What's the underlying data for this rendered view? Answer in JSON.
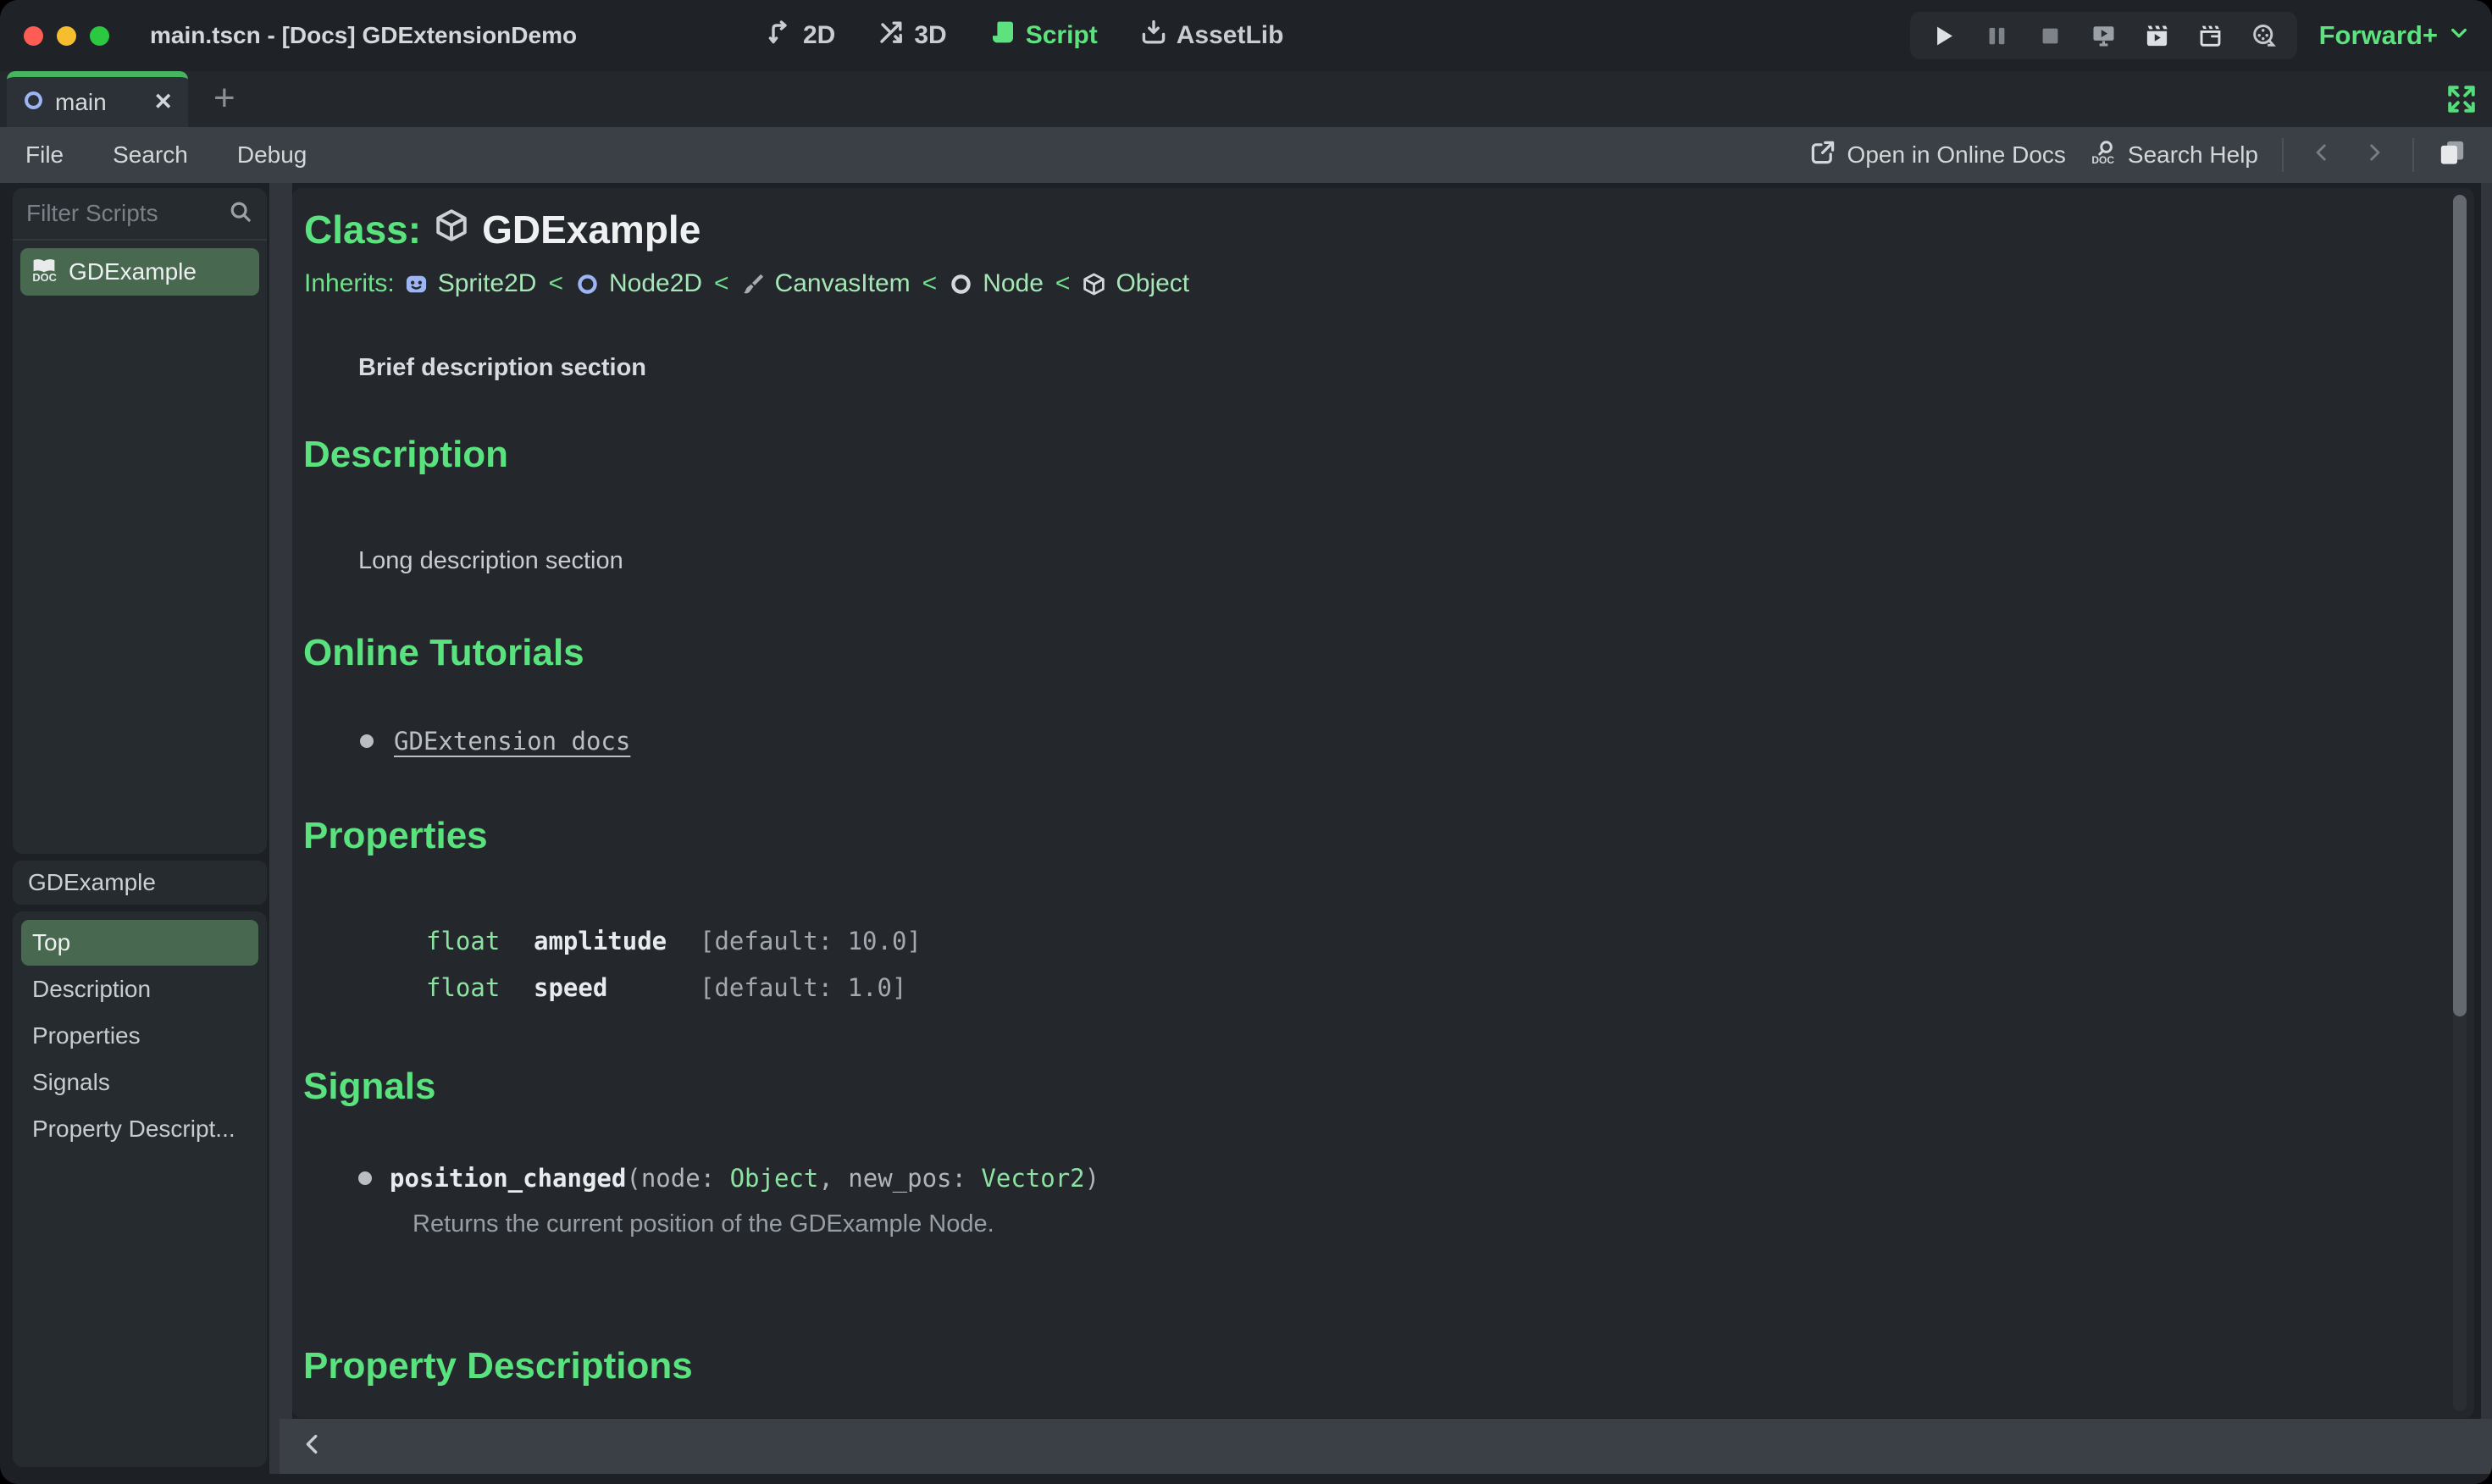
{
  "titlebar": {
    "title": "main.tscn - [Docs] GDExtensionDemo",
    "workspaces": {
      "d2": "2D",
      "d3": "3D",
      "script": "Script",
      "assetlib": "AssetLib"
    },
    "renderer": "Forward+"
  },
  "tabbar": {
    "tab": "main"
  },
  "icons": {
    "close": "✕",
    "plus": "+"
  },
  "menubar": {
    "file": "File",
    "search": "Search",
    "debug": "Debug",
    "open_online_docs": "Open in Online Docs",
    "search_help": "Search Help"
  },
  "sidebar": {
    "filter_placeholder": "Filter Scripts",
    "script_item": "GDExample",
    "member_filter": "GDExample",
    "members": [
      {
        "label": "Top"
      },
      {
        "label": "Description"
      },
      {
        "label": "Properties"
      },
      {
        "label": "Signals"
      },
      {
        "label": "Property Descript..."
      }
    ]
  },
  "doc": {
    "class_label": "Class:",
    "class_name": "GDExample",
    "inherits_label": "Inherits:",
    "sep": "<",
    "chain": [
      {
        "name": "Sprite2D"
      },
      {
        "name": "Node2D"
      },
      {
        "name": "CanvasItem"
      },
      {
        "name": "Node"
      },
      {
        "name": "Object"
      }
    ],
    "brief": "Brief description section",
    "description": {
      "title": "Description",
      "body": "Long description section"
    },
    "tutorials": {
      "title": "Online Tutorials",
      "link": "GDExtension docs"
    },
    "properties": {
      "title": "Properties",
      "rows": [
        {
          "type": "float",
          "name": "amplitude",
          "default": "[default: 10.0]"
        },
        {
          "type": "float",
          "name": "speed",
          "default": "[default: 1.0]"
        }
      ]
    },
    "signals": {
      "title": "Signals",
      "item": {
        "name": "position_changed",
        "open": "(",
        "p1_label": "node: ",
        "p1_type": "Object",
        "sep": ", ",
        "p2_label": "new_pos: ",
        "p2_type": "Vector2",
        "close": ")",
        "description": "Returns the current position of the GDExample Node."
      }
    },
    "property_descriptions": {
      "title": "Property Descriptions"
    }
  },
  "colors": {
    "accent_green": "#5ee27f",
    "heading_green": "#59e27d",
    "selection_green": "#48684f",
    "link_pale_green": "#a6e7b6",
    "code_green": "#8ce2a0",
    "node_blue": "#9db5f3",
    "tab_border_green": "#47b45f",
    "traffic_red": "#fe5d55",
    "traffic_yellow": "#f6bd2e",
    "traffic_green": "#2bc841"
  }
}
